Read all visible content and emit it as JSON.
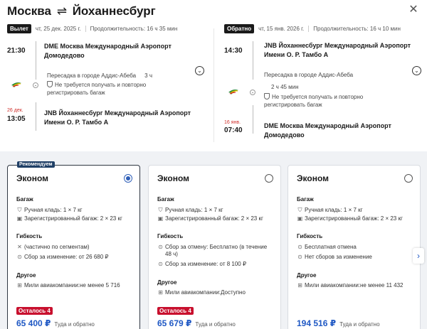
{
  "header": {
    "origin": "Москва",
    "swap_symbol": "⇌",
    "destination": "Йоханнесбург",
    "close_icon": "close-icon"
  },
  "outbound": {
    "badge": "Вылет",
    "date": "чт, 25 дек. 2025 г.",
    "duration": "Продолжительность: 16 ч 35 мин",
    "dep_time": "21:30",
    "dep_airport_line1": "DME Москва Международный Аэропорт",
    "dep_airport_line2": "Домодедово",
    "transfer": "Пересадка в городе Аддис-Абеба",
    "transfer_duration": "3 ч",
    "bag_note_line1": "Не требуется получать и повторно",
    "bag_note_line2": "регистрировать багаж",
    "arr_date": "26 дек.",
    "arr_time": "13:05",
    "arr_airport_line1": "JNB Йоханнесбург Международный Аэропорт",
    "arr_airport_line2": "Имени О. Р. Тамбо А"
  },
  "return": {
    "badge": "Обратно",
    "date": "чт, 15 янв. 2026 г.",
    "duration": "Продолжительность: 16 ч 10 мин",
    "dep_time": "14:30",
    "dep_airport_line1": "JNB Йоханнесбург Международный Аэропорт",
    "dep_airport_line2": "Имени О. Р. Тамбо А",
    "transfer": "Пересадка в городе Аддис-Абеба",
    "transfer_duration": "2 ч 45 мин",
    "bag_note_line1": "Не требуется получать и повторно",
    "bag_note_line2": "регистрировать багаж",
    "arr_date": "16 янв.",
    "arr_time": "07:40",
    "arr_airport_line1": "DME Москва Международный Аэропорт",
    "arr_airport_line2": "Домодедово"
  },
  "fares": [
    {
      "recommended": "Рекомендуем",
      "name": "Эконом",
      "selected": true,
      "baggage_title": "Багаж",
      "carry_on": "Ручная кладь: 1 × 7 кг",
      "checked": "Зарегистрированный багаж: 2 × 23 кг",
      "flex_title": "Гибкость",
      "flex1": "(частично по сегментам)",
      "flex2": "Сбор за изменение: от 26 680 ₽",
      "other_title": "Другое",
      "miles": "Мили авиакомпании:не менее 5 716",
      "remaining": "Осталось 4",
      "price": "65 400 ₽",
      "price_note": "Туда и обратно"
    },
    {
      "name": "Эконом",
      "selected": false,
      "baggage_title": "Багаж",
      "carry_on": "Ручная кладь: 1 × 7 кг",
      "checked": "Зарегистрированный багаж: 2 × 23 кг",
      "flex_title": "Гибкость",
      "flex1_line1": "Сбор за отмену: Бесплатно (в течение",
      "flex1_line2": "48 ч)",
      "flex2": "Сбор за изменение: от 8 100 ₽",
      "other_title": "Другое",
      "miles": "Мили авиакомпании:Доступно",
      "remaining": "Осталось 4",
      "price": "65 679 ₽",
      "price_note": "Туда и обратно"
    },
    {
      "name": "Эконом",
      "selected": false,
      "baggage_title": "Багаж",
      "carry_on": "Ручная кладь: 1 × 7 кг",
      "checked": "Зарегистрированный багаж: 2 × 23 кг",
      "flex_title": "Гибкость",
      "flex1": "Бесплатная отмена",
      "flex2": "Нет сборов за изменение",
      "other_title": "Другое",
      "miles": "Мили авиакомпании:не менее 11 432",
      "price": "194 516 ₽",
      "price_note": "Туда и обратно"
    }
  ],
  "colors": {
    "price_blue": "#1f58c4",
    "remaining_red": "#c8102e",
    "ribbon_navy": "#1f3f66",
    "fare_bg": "#f0f2f5"
  }
}
